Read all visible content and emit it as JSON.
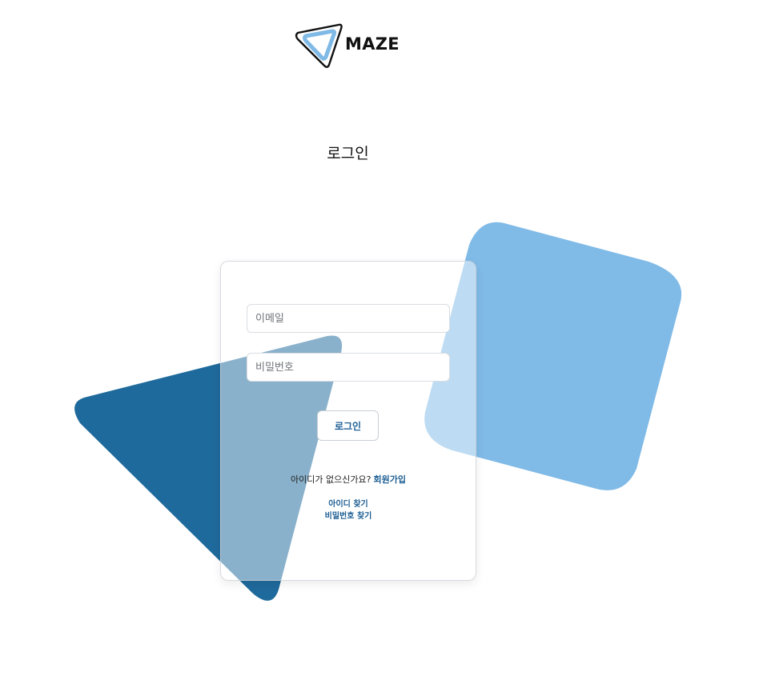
{
  "brand": {
    "name": "MAZE",
    "logo_icon": "triangle-logo-icon",
    "logo_outline_color": "#111111",
    "logo_fill_color": "#7fb9e6"
  },
  "page": {
    "title": "로그인"
  },
  "form": {
    "email_placeholder": "이메일",
    "password_placeholder": "비밀번호",
    "login_button_label": "로그인",
    "signup_prompt": "아이디가 없으신가요?",
    "signup_link": "회원가입",
    "find_id_link": "아이디 찾기",
    "find_password_link": "비밀번호 찾기"
  },
  "colors": {
    "accent": "#1e5f94",
    "triangle_shape": "#1f6a9c",
    "square_shape": "#80bae7"
  }
}
